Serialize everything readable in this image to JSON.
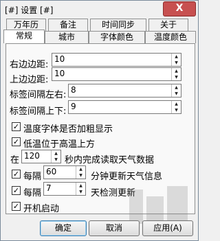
{
  "window": {
    "title": "[#] 设置 [#]",
    "close_glyph": "X"
  },
  "tabs": {
    "row_back": [
      "万年历",
      "备注",
      "时间同步",
      "关于"
    ],
    "row_front": [
      "常规",
      "城市",
      "字体颜色",
      "温度颜色"
    ],
    "active": "常规"
  },
  "general": {
    "right_margin_label": "右边边距:",
    "right_margin_value": "10",
    "top_margin_label": "上边边距:",
    "top_margin_value": "10",
    "label_gap_lr_label": "标签间隔左右:",
    "label_gap_lr_value": "8",
    "label_gap_ud_label": "标签间隔上下:",
    "label_gap_ud_value": "9",
    "bold_temp_label": "温度字体是否加粗显示",
    "bold_temp_checked": true,
    "low_temp_top_label": "低温位于高温上方",
    "low_temp_top_checked": true,
    "read_prefix": "在",
    "read_seconds_value": "120",
    "read_suffix": "秒内完成读取天气数据",
    "weather_every_label": "每隔",
    "weather_every_checked": true,
    "weather_minutes_value": "60",
    "weather_suffix": "分钟更新天气信息",
    "days_every_label": "每隔",
    "days_every_checked": true,
    "days_value": "7",
    "days_suffix": "天检测更新",
    "autostart_label": "开机启动",
    "autostart_checked": true
  },
  "buttons": {
    "ok": "确定",
    "cancel": "取消",
    "apply": "应用(A)"
  }
}
